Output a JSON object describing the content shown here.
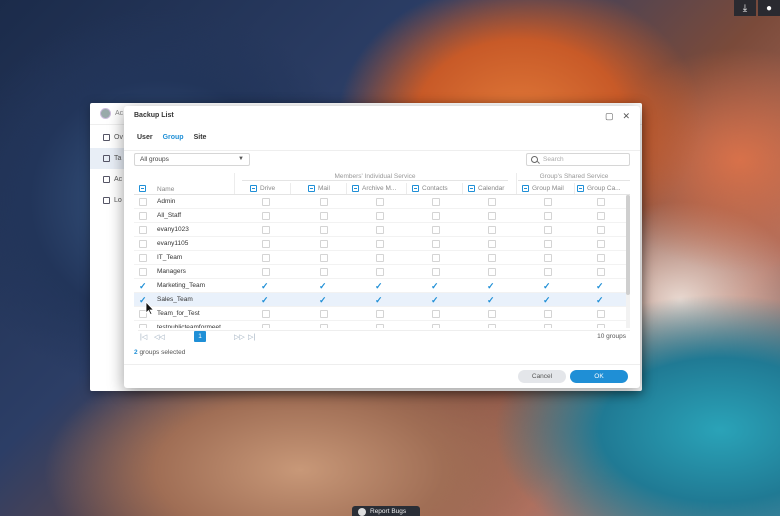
{
  "background_window": {
    "title": "Ac",
    "sidebar": [
      "Ov",
      "Ta",
      "Ac",
      "Lo"
    ]
  },
  "dialog": {
    "title": "Backup List",
    "tabs": [
      "User",
      "Group",
      "Site"
    ],
    "active_tab": "Group",
    "filter_value": "All groups",
    "search_placeholder": "Search",
    "group_headers": {
      "individual": "Members' Individual Service",
      "shared": "Group's Shared Service"
    },
    "columns": [
      "Name",
      "Drive",
      "Mail",
      "Archive M...",
      "Contacts",
      "Calendar",
      "Group Mail",
      "Group Ca..."
    ],
    "rows": [
      {
        "name": "Admin",
        "selected": false,
        "checks": [
          false,
          false,
          false,
          false,
          false,
          false,
          false
        ]
      },
      {
        "name": "All_Staff",
        "selected": false,
        "checks": [
          false,
          false,
          false,
          false,
          false,
          false,
          false
        ]
      },
      {
        "name": "evany1023",
        "selected": false,
        "checks": [
          false,
          false,
          false,
          false,
          false,
          false,
          false
        ]
      },
      {
        "name": "evany1105",
        "selected": false,
        "checks": [
          false,
          false,
          false,
          false,
          false,
          false,
          false
        ]
      },
      {
        "name": "IT_Team",
        "selected": false,
        "checks": [
          false,
          false,
          false,
          false,
          false,
          false,
          false
        ]
      },
      {
        "name": "Managers",
        "selected": false,
        "checks": [
          false,
          false,
          false,
          false,
          false,
          false,
          false
        ]
      },
      {
        "name": "Marketing_Team",
        "selected": true,
        "checks": [
          true,
          true,
          true,
          true,
          true,
          true,
          true
        ]
      },
      {
        "name": "Sales_Team",
        "selected": true,
        "checks": [
          true,
          true,
          true,
          true,
          true,
          true,
          true
        ]
      },
      {
        "name": "Team_for_Test",
        "selected": false,
        "checks": [
          false,
          false,
          false,
          false,
          false,
          false,
          false
        ]
      },
      {
        "name": "testpublicteamformeet",
        "selected": false,
        "checks": [
          false,
          false,
          false,
          false,
          false,
          false,
          false
        ]
      }
    ],
    "pager": {
      "first": "|◁",
      "prev": "◁◁",
      "page": "1",
      "next": "▷▷",
      "last": "▷|",
      "total": "10 groups"
    },
    "selected_count": "2",
    "selected_text": "groups selected",
    "cancel_label": "Cancel",
    "ok_label": "OK"
  },
  "taskbar": {
    "report_label": "Report Bugs"
  },
  "colors": {
    "accent": "#1f8fd6",
    "highlight_row": "#e9f1fb"
  }
}
